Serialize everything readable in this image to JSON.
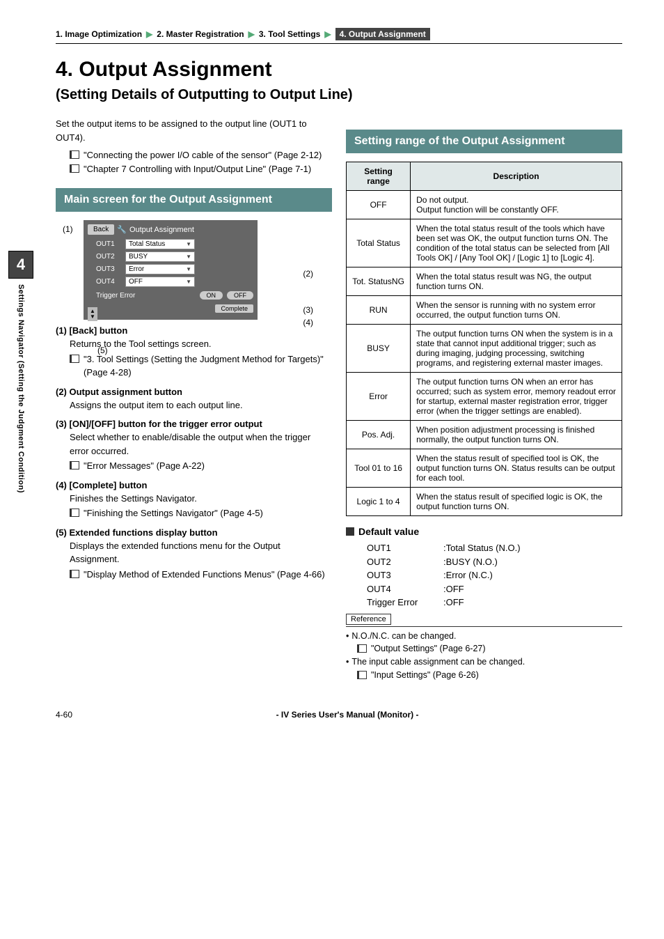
{
  "breadcrumb": {
    "b1": "1. Image Optimization",
    "b2": "2. Master Registration",
    "b3": "3. Tool Settings",
    "b4": "4. Output Assignment"
  },
  "title": "4. Output Assignment",
  "subtitle": "(Setting Details of Outputting to Output Line)",
  "intro": "Set the output items to be assigned to the output line (OUT1 to OUT4).",
  "refs": {
    "r1": "\"Connecting the power I/O cable of the sensor\" (Page 2-12)",
    "r2": "\"Chapter 7  Controlling with Input/Output Line\" (Page 7-1)"
  },
  "section1": "Main screen for the Output Assignment",
  "diagram": {
    "back": "Back",
    "title": "Output Assignment",
    "out1": "OUT1",
    "out2": "OUT2",
    "out3": "OUT3",
    "out4": "OUT4",
    "v1": "Total Status",
    "v2": "BUSY",
    "v3": "Error",
    "v4": "OFF",
    "trigger": "Trigger Error",
    "on": "ON",
    "off": "OFF",
    "complete": "Complete"
  },
  "callouts": {
    "c1": "(1)",
    "c2": "(2)",
    "c3": "(3)",
    "c4": "(4)",
    "c5": "(5)"
  },
  "items": {
    "i1h": "(1) [Back] button",
    "i1b": "Returns to the Tool settings screen.",
    "i1r": "\"3. Tool Settings (Setting the Judgment Method for Targets)\" (Page 4-28)",
    "i2h": "(2) Output assignment button",
    "i2b": "Assigns the output item to each output line.",
    "i3h": "(3) [ON]/[OFF] button for the trigger error output",
    "i3b": "Select whether to enable/disable the output when the trigger error occurred.",
    "i3r": "\"Error Messages\" (Page A-22)",
    "i4h": "(4) [Complete] button",
    "i4b": "Finishes the Settings Navigator.",
    "i4r": "\"Finishing the Settings Navigator\" (Page 4-5)",
    "i5h": "(5) Extended functions display button",
    "i5b": "Displays the extended functions menu for the Output Assignment.",
    "i5r": "\"Display Method of Extended Functions Menus\" (Page 4-66)"
  },
  "section2": "Setting range of the Output Assignment",
  "table": {
    "h1": "Setting range",
    "h2": "Description",
    "rows": [
      {
        "k": "OFF",
        "d": "Do not output.\nOutput function will be constantly OFF."
      },
      {
        "k": "Total Status",
        "d": "When the total status result of the tools which have been set was OK, the output function turns ON. The condition of the total status can be selected from [All Tools OK] / [Any Tool OK] / [Logic 1] to [Logic 4]."
      },
      {
        "k": "Tot. StatusNG",
        "d": "When the total status result was NG, the output function turns ON."
      },
      {
        "k": "RUN",
        "d": "When the sensor is running with no system error occurred, the output function turns ON."
      },
      {
        "k": "BUSY",
        "d": "The output function turns ON when the system is in a state that cannot input additional trigger; such as during imaging, judging processing, switching programs, and registering external master images."
      },
      {
        "k": "Error",
        "d": "The output function turns ON when an error has occurred; such as system error, memory readout error for startup, external master registration error, trigger error (when the trigger settings are enabled)."
      },
      {
        "k": "Pos. Adj.",
        "d": "When position adjustment processing is finished normally, the output function turns ON."
      },
      {
        "k": "Tool 01 to 16",
        "d": "When the status result of specified tool is OK, the output function turns ON. Status results can be output for each tool."
      },
      {
        "k": "Logic 1 to 4",
        "d": "When the status result of specified logic is OK, the output function turns ON."
      }
    ]
  },
  "defaults": {
    "head": "Default value",
    "rows": [
      {
        "k": "OUT1",
        "v": ":Total Status (N.O.)"
      },
      {
        "k": "OUT2",
        "v": ":BUSY (N.O.)"
      },
      {
        "k": "OUT3",
        "v": ":Error (N.C.)"
      },
      {
        "k": "OUT4",
        "v": ":OFF"
      },
      {
        "k": "Trigger Error",
        "v": ":OFF"
      }
    ]
  },
  "reference": {
    "label": "Reference",
    "n1": "N.O./N.C. can be changed.",
    "n1r": "\"Output Settings\" (Page 6-27)",
    "n2": "The input cable assignment can be changed.",
    "n2r": "\"Input Settings\" (Page 6-26)"
  },
  "sidetab": {
    "num": "4",
    "label": "Settings Navigator (Setting the Judgment Condition)"
  },
  "footer": {
    "page": "4-60",
    "center": "- IV Series User's Manual (Monitor) -"
  }
}
